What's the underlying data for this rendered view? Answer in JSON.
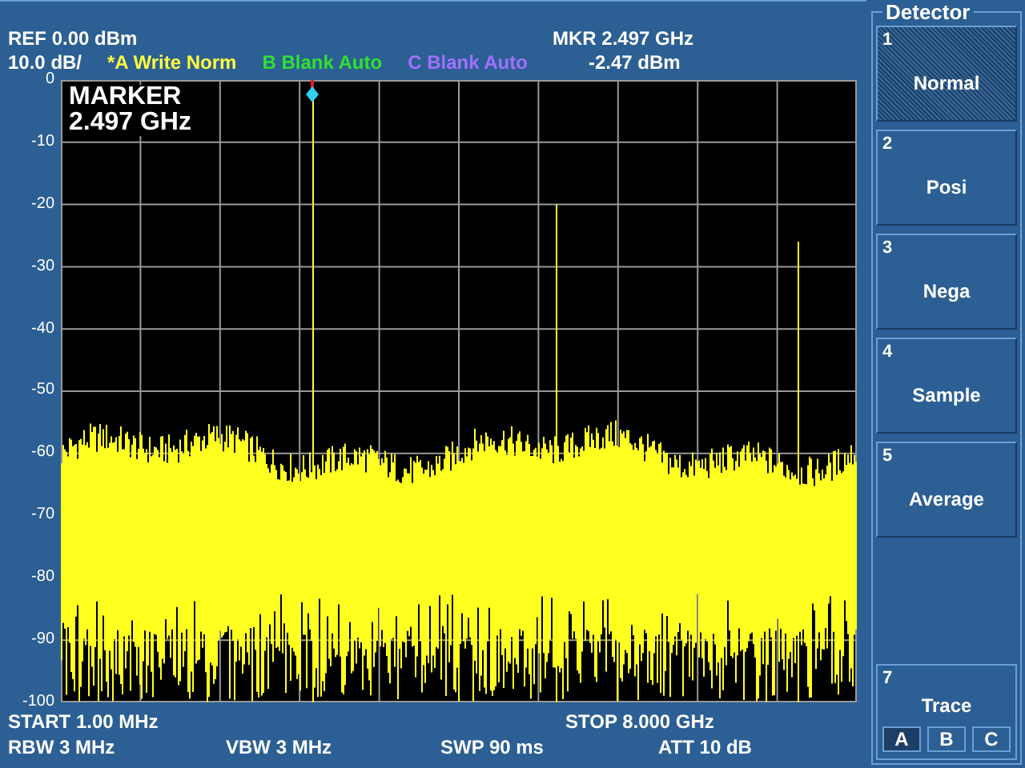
{
  "header": {
    "ref": "REF  0.00 dBm",
    "scale": "10.0 dB/",
    "marker_frequency": "MKR 2.497 GHz",
    "marker_level": "-2.47 dBm",
    "traces": [
      {
        "label": "*A Write Norm",
        "color": "#ffff40"
      },
      {
        "label": "B Blank Auto",
        "color": "#30e030"
      },
      {
        "label": "C Blank Auto",
        "color": "#a070ff"
      }
    ]
  },
  "plot": {
    "marker_title": "MARKER",
    "marker_value": "2.497 GHz",
    "y_labels": [
      "0",
      "-10",
      "-20",
      "-30",
      "-40",
      "-50",
      "-60",
      "-70",
      "-80",
      "-90",
      "-100"
    ]
  },
  "footer": {
    "start": "START  1.00 MHz",
    "stop": "STOP 8.000 GHz",
    "rbw": "RBW  3 MHz",
    "vbw": "VBW  3 MHz",
    "sweep": "SWP  90 ms",
    "attenuation": "ATT 10 dB"
  },
  "softkeys": {
    "title": "Detector",
    "keys": [
      {
        "kind": "key",
        "number": "1",
        "label": "Normal",
        "selected": true
      },
      {
        "kind": "key",
        "number": "2",
        "label": "Posi",
        "selected": false
      },
      {
        "kind": "key",
        "number": "3",
        "label": "Nega",
        "selected": false
      },
      {
        "kind": "key",
        "number": "4",
        "label": "Sample",
        "selected": false
      },
      {
        "kind": "key",
        "number": "5",
        "label": "Average",
        "selected": false
      },
      {
        "kind": "blank"
      },
      {
        "kind": "trace",
        "number": "7",
        "label": "Trace",
        "options": [
          {
            "label": "A",
            "selected": true
          },
          {
            "label": "B",
            "selected": false
          },
          {
            "label": "C",
            "selected": false
          }
        ]
      }
    ]
  }
}
